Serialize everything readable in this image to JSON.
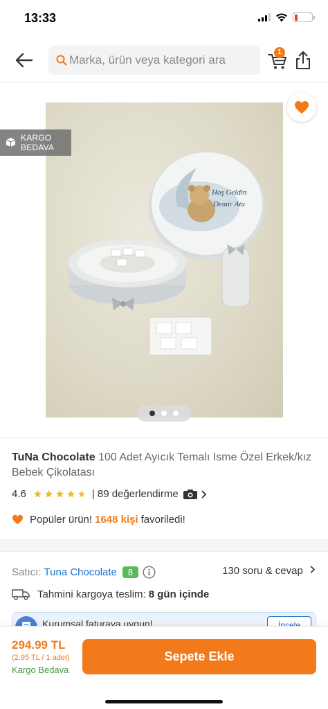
{
  "status_bar": {
    "time": "13:33",
    "battery_color": "#e8472b"
  },
  "header": {
    "back_icon": "arrow-left-icon",
    "search": {
      "placeholder": "Marka, ürün veya kategori ara",
      "icon": "search-icon"
    },
    "cart": {
      "icon": "cart-icon",
      "badge_count": "1"
    },
    "share_icon": "share-icon"
  },
  "gallery": {
    "image": {
      "alt": "Product photo",
      "lid_text_line1": "Hoş Geldin",
      "lid_text_line2": "Demir Ata"
    },
    "favorite_icon": "heart-icon",
    "cargo_badge": {
      "line1": "KARGO",
      "line2": "BEDAVA",
      "icon": "box-icon"
    },
    "slides": 3,
    "active_slide": 1
  },
  "product": {
    "brand": "TuNa Chocolate",
    "name": "100 Adet Ayıcık Temalı Isme Özel Erkek/kız Bebek Çikolatası",
    "rating": "4.6",
    "rating_value": 4.6,
    "reviews_text": "| 89 değerlendirme",
    "popular": {
      "prefix": "Popüler ürün!",
      "count": "1648 kişi",
      "suffix": "favoriledi!"
    }
  },
  "seller": {
    "label": "Satıcı:",
    "name": "Tuna Chocolate",
    "score": "8",
    "qa_link": "130 soru & cevap"
  },
  "delivery": {
    "label": "Tahmini kargoya teslim:",
    "value": "8 gün içinde"
  },
  "corporate": {
    "text": "Kurumsal faturaya uygun!",
    "link": "İncele"
  },
  "bottom_bar": {
    "price": "294.99 TL",
    "unit_price": "(2.95 TL / 1 adet)",
    "shipping": "Kargo Bedava",
    "add_to_cart": "Sepete Ekle"
  },
  "colors": {
    "accent": "#f27a1a",
    "link": "#1a73c9",
    "success": "#3f9d48",
    "seller_score": "#5cb85c"
  }
}
